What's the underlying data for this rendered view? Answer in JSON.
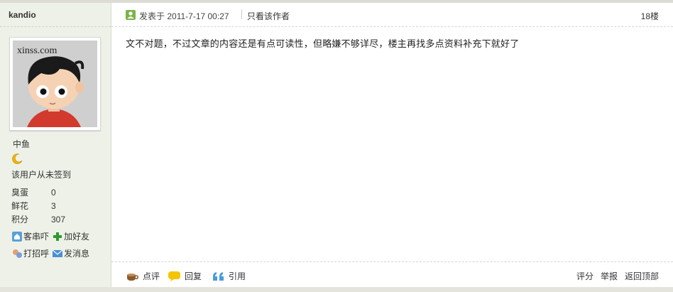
{
  "author": {
    "name": "kandio",
    "avatar_text": "xinss.com",
    "rank": "中鱼",
    "sign_status": "该用户从未签到",
    "stats": [
      {
        "label": "臭蛋",
        "value": "0"
      },
      {
        "label": "鲜花",
        "value": "3"
      },
      {
        "label": "积分",
        "value": "307"
      }
    ],
    "actions": {
      "visit": "客串吓",
      "add_friend": "加好友",
      "greet": "打招呼",
      "message": "发消息"
    }
  },
  "post": {
    "posted_label": "发表于",
    "posted_time": "2011-7-17 00:27",
    "only_author": "只看该作者",
    "floor": "18楼",
    "content": "文不对题，不过文章的内容还是有点可读性，但略嫌不够详尽，楼主再找多点资料补充下就好了"
  },
  "footer": {
    "comment": "点评",
    "reply": "回复",
    "quote": "引用",
    "rate": "评分",
    "report": "举报",
    "back_top": "返回顶部"
  },
  "colors": {
    "sidebar_bg": "#eef1e8",
    "accent_green": "#7ab34a",
    "link_blue": "#336699"
  }
}
